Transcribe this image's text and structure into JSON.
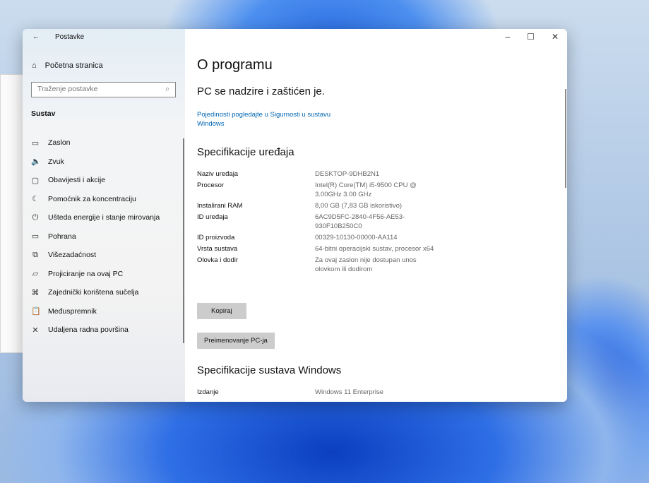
{
  "window": {
    "title": "Postavke",
    "minimize": "–",
    "maximize": "☐",
    "close": "✕"
  },
  "sidebar": {
    "home": "Početna stranica",
    "search_placeholder": "Traženje postavke",
    "section": "Sustav",
    "items": [
      {
        "label": "Zaslon",
        "icon": "▭"
      },
      {
        "label": "Zvuk",
        "icon": "🔈"
      },
      {
        "label": "Obavijesti i akcije",
        "icon": "▢"
      },
      {
        "label": "Pomoćnik za koncentraciju",
        "icon": "☾"
      },
      {
        "label": "Ušteda energije i stanje mirovanja",
        "icon": "⏻"
      },
      {
        "label": "Pohrana",
        "icon": "▭"
      },
      {
        "label": "Višezadaćnost",
        "icon": "⧉"
      },
      {
        "label": "Projiciranje na ovaj PC",
        "icon": "▱"
      },
      {
        "label": "Zajednički korištena sučelja",
        "icon": "⌘"
      },
      {
        "label": "Međuspremnik",
        "icon": "📋"
      },
      {
        "label": "Udaljena radna površina",
        "icon": "✕"
      }
    ]
  },
  "main": {
    "title": "O programu",
    "protection": "PC se nadzire i zaštićen je.",
    "security_link": "Pojedinosti pogledajte u Sigurnosti u sustavu Windows",
    "device_heading": "Specifikacije uređaja",
    "specs": [
      {
        "k": "Naziv uređaja",
        "v": "DESKTOP-9DHB2N1"
      },
      {
        "k": "Procesor",
        "v": "Intel(R) Core(TM) i5-9500 CPU @ 3.00GHz   3.00 GHz"
      },
      {
        "k": "Instalirani RAM",
        "v": "8,00 GB (7,83 GB iskoristivo)"
      },
      {
        "k": "ID uređaja",
        "v": "6AC9D5FC-2840-4F56-AE53-930F10B250C0"
      },
      {
        "k": "ID proizvoda",
        "v": "00329-10130-00000-AA114"
      },
      {
        "k": "Vrsta sustava",
        "v": "64-bitni operacijski sustav, procesor x64"
      },
      {
        "k": "Olovka i dodir",
        "v": "Za ovaj zaslon nije dostupan unos olovkom ili dodirom"
      }
    ],
    "copy_button": "Kopiraj",
    "rename_button": "Preimenovanje PC-ja",
    "windows_heading": "Specifikacije sustava Windows",
    "edition_label": "Izdanje",
    "edition_value": "Windows 11 Enterprise"
  }
}
